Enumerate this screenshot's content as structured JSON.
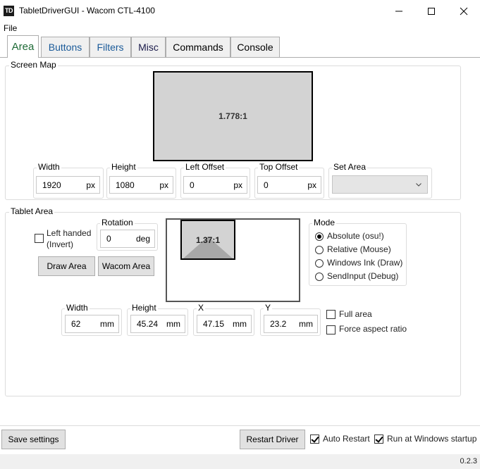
{
  "window": {
    "icon_text": "TD",
    "title": "TabletDriverGUI - Wacom CTL-4100"
  },
  "menu": {
    "file": "File"
  },
  "tabs": [
    {
      "label": "Area",
      "active": true
    },
    {
      "label": "Buttons"
    },
    {
      "label": "Filters"
    },
    {
      "label": "Misc"
    },
    {
      "label": "Commands"
    },
    {
      "label": "Console"
    }
  ],
  "screen_map": {
    "title": "Screen Map",
    "ratio": "1.778:1",
    "width": {
      "label": "Width",
      "value": "1920",
      "unit": "px"
    },
    "height": {
      "label": "Height",
      "value": "1080",
      "unit": "px"
    },
    "left_offset": {
      "label": "Left Offset",
      "value": "0",
      "unit": "px"
    },
    "top_offset": {
      "label": "Top Offset",
      "value": "0",
      "unit": "px"
    },
    "set_area": {
      "label": "Set Area",
      "selected": ""
    }
  },
  "tablet_area": {
    "title": "Tablet Area",
    "left_handed": {
      "label_line1": "Left handed",
      "label_line2": "(Invert)",
      "checked": false
    },
    "rotation": {
      "label": "Rotation",
      "value": "0",
      "unit": "deg"
    },
    "draw_area_label": "Draw Area",
    "wacom_area_label": "Wacom Area",
    "ratio": "1.37:1",
    "mode": {
      "label": "Mode",
      "options": [
        "Absolute (osu!)",
        "Relative (Mouse)",
        "Windows Ink (Draw)",
        "SendInput (Debug)"
      ],
      "selected": "Absolute (osu!)"
    },
    "width": {
      "label": "Width",
      "value": "62",
      "unit": "mm"
    },
    "height": {
      "label": "Height",
      "value": "45.24",
      "unit": "mm"
    },
    "x": {
      "label": "X",
      "value": "47.15",
      "unit": "mm"
    },
    "y": {
      "label": "Y",
      "value": "23.2",
      "unit": "mm"
    },
    "full_area": {
      "label": "Full area",
      "checked": false
    },
    "force_aspect": {
      "label": "Force aspect ratio",
      "checked": false
    }
  },
  "footer": {
    "save_settings": "Save settings",
    "restart_driver": "Restart Driver",
    "auto_restart": {
      "label": "Auto Restart",
      "checked": true
    },
    "run_at_startup": {
      "label": "Run at Windows startup",
      "checked": true
    }
  },
  "status": {
    "version": "0.2.3"
  }
}
